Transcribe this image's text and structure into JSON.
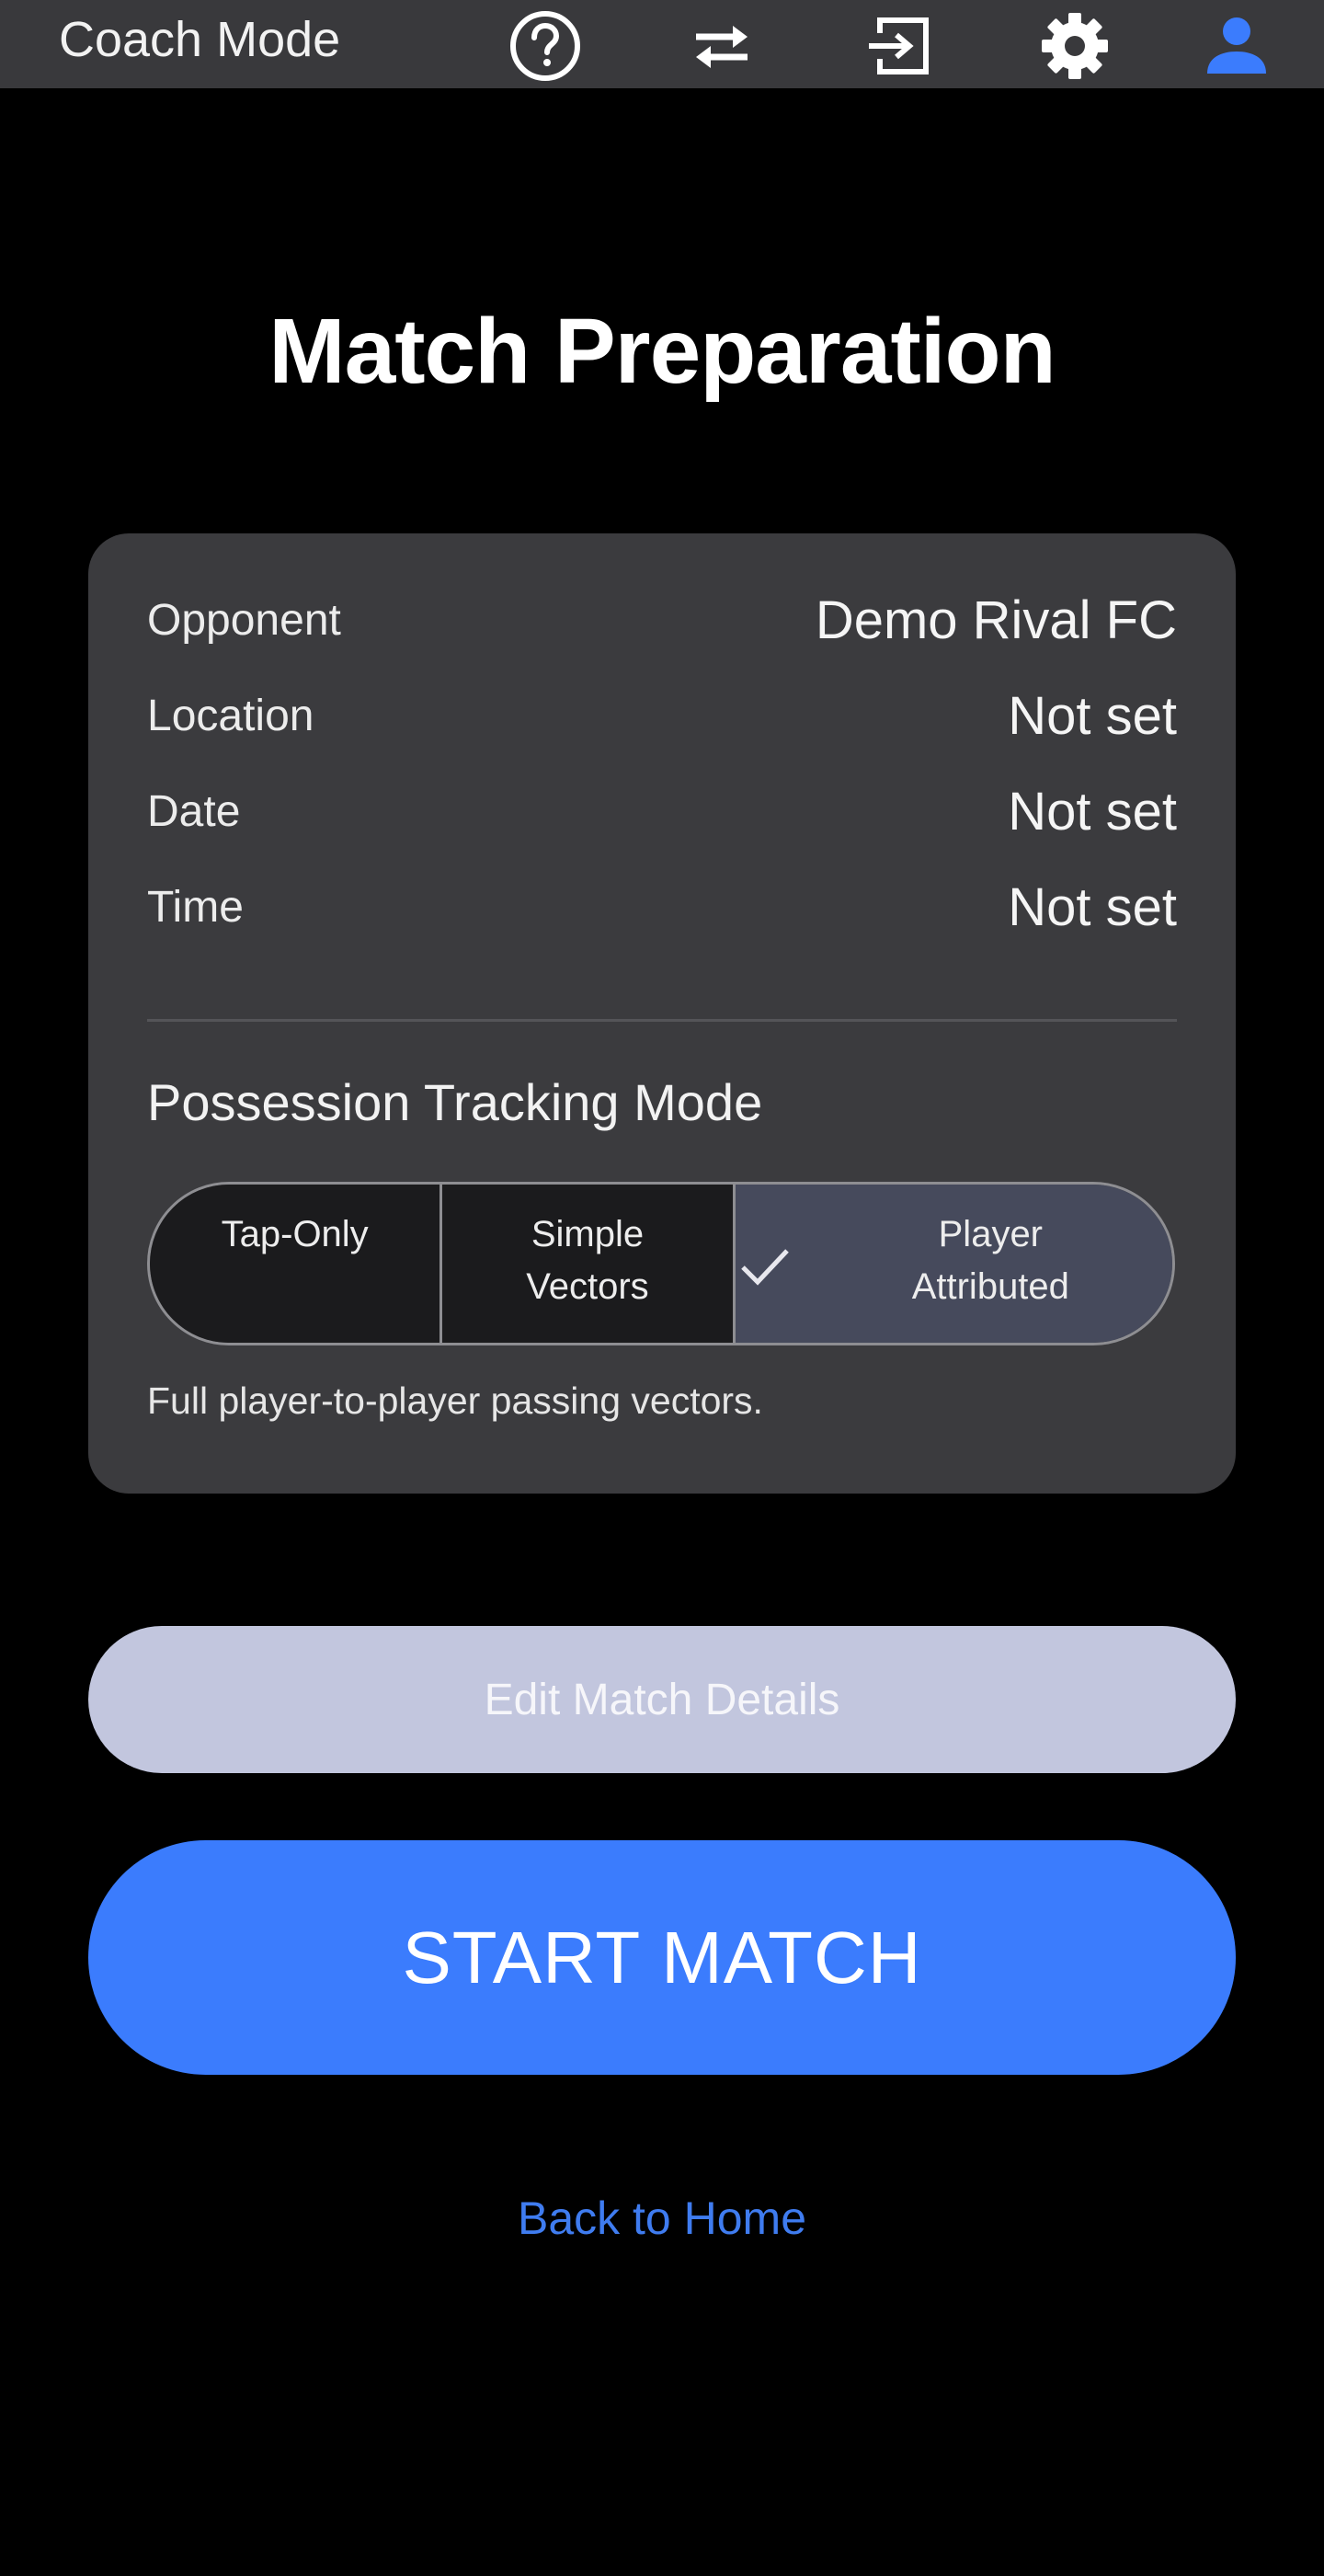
{
  "appbar": {
    "title": "Coach Mode",
    "icons": [
      "help-icon",
      "swap-icon",
      "exit-icon",
      "gear-icon",
      "account-icon"
    ],
    "accent_color": "#3b7cfd"
  },
  "page": {
    "title": "Match Preparation"
  },
  "match_details": {
    "rows": [
      {
        "label": "Opponent",
        "value": "Demo Rival FC"
      },
      {
        "label": "Location",
        "value": "Not set"
      },
      {
        "label": "Date",
        "value": "Not set"
      },
      {
        "label": "Time",
        "value": "Not set"
      }
    ]
  },
  "possession": {
    "title": "Possession Tracking Mode",
    "options": [
      {
        "label": "Tap-Only",
        "selected": false
      },
      {
        "label": "Simple\nVectors",
        "selected": false
      },
      {
        "label": "Player\nAttributed",
        "selected": true
      }
    ],
    "description": "Full player-to-player passing vectors."
  },
  "actions": {
    "edit_label": "Edit Match Details",
    "start_label": "START MATCH",
    "back_label": "Back to Home"
  }
}
